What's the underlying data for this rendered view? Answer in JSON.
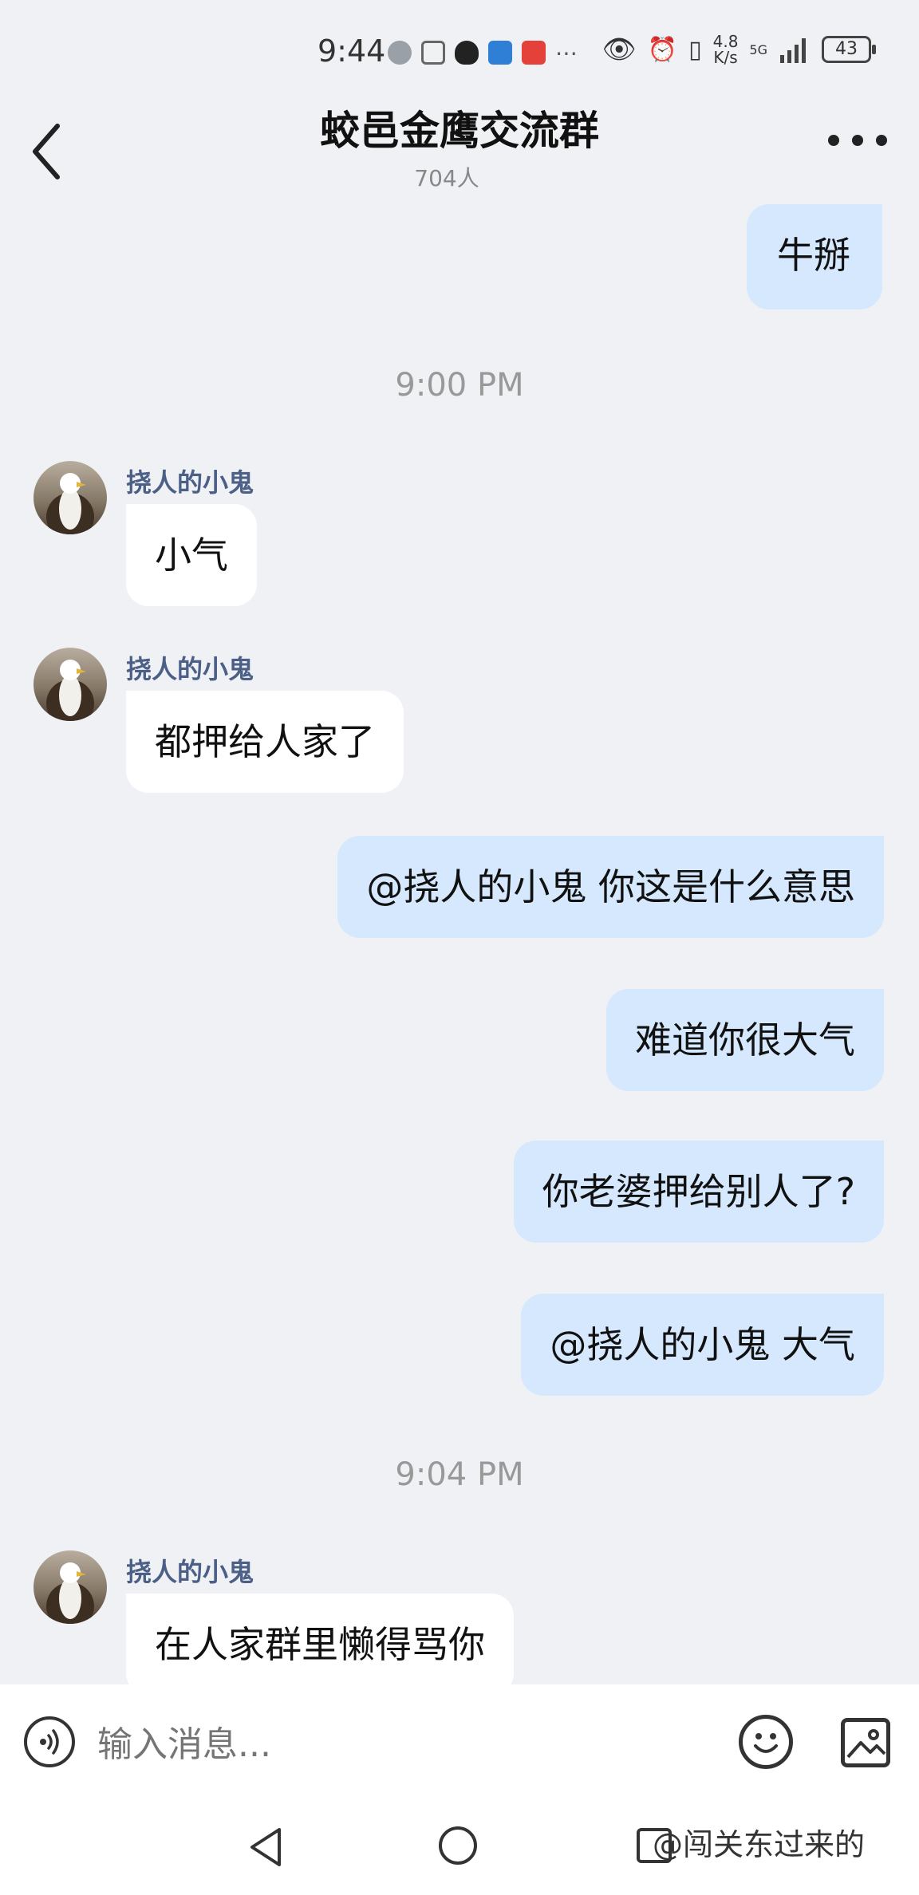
{
  "status_bar": {
    "time": "9:44",
    "net_speed_top": "4.8",
    "net_speed_bottom": "K/s",
    "signal_label": "5G",
    "battery": "43"
  },
  "header": {
    "title": "蛟邑金鹰交流群",
    "member_count": "704人"
  },
  "messages": {
    "m1": "牛掰",
    "time1": "9:00 PM",
    "m2_sender": "挠人的小鬼",
    "m2": "小气",
    "m3_sender": "挠人的小鬼",
    "m3": "都押给人家了",
    "m4": "@挠人的小鬼 你这是什么意思",
    "m5": "难道你很大气",
    "m6": "你老婆押给别人了?",
    "m7": "@挠人的小鬼 大气",
    "time2": "9:04 PM",
    "m8_sender": "挠人的小鬼",
    "m8": "在人家群里懒得骂你"
  },
  "input": {
    "placeholder": "输入消息..."
  },
  "watermark": "@闯关东过来的",
  "colors": {
    "outgoing_bubble": "#d5e8fd",
    "incoming_bubble": "#ffffff",
    "background": "#f0f1f5",
    "sender_name": "#4c5f87"
  }
}
